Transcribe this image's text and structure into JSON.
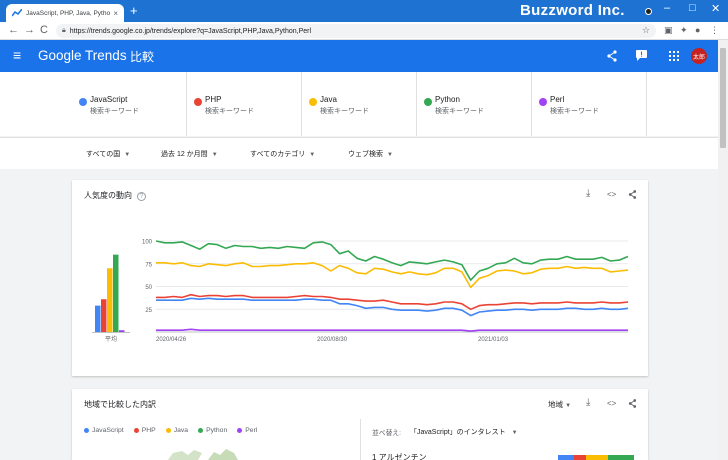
{
  "browser": {
    "tab_title": "JavaScript, PHP, Java, Python, Per",
    "tab_close": "×",
    "new_tab": "+",
    "brand": "Buzzword Inc.",
    "url": "https://trends.google.co.jp/trends/explore?q=JavaScript,PHP,Java,Python,Perl",
    "win_min": "–",
    "win_max": "□",
    "win_close": "✕",
    "back": "←",
    "forward": "→",
    "reload": "C"
  },
  "header": {
    "menu_icon": "≡",
    "logo_google": "Google",
    "logo_trends": " Trends",
    "title": "比較",
    "share_icon": "<",
    "feedback_icon": "!",
    "apps_icon": "⋮⋮⋮",
    "avatar_text": "太郎",
    "avatar_color": "#c5221f"
  },
  "terms": [
    {
      "name": "JavaScript",
      "sub": "検索キーワード",
      "color": "#4285f4"
    },
    {
      "name": "PHP",
      "sub": "検索キーワード",
      "color": "#ea4335"
    },
    {
      "name": "Java",
      "sub": "検索キーワード",
      "color": "#fbbc04"
    },
    {
      "name": "Python",
      "sub": "検索キーワード",
      "color": "#34a853"
    },
    {
      "name": "Perl",
      "sub": "検索キーワード",
      "color": "#a142f4"
    }
  ],
  "filters": [
    {
      "label": "すべての国"
    },
    {
      "label": "過去 12 か月間"
    },
    {
      "label": "すべてのカテゴリ"
    },
    {
      "label": "ウェブ検索"
    }
  ],
  "interest_card": {
    "title": "人気度の動向",
    "help": "?",
    "download_icon": "⤓",
    "embed_icon": "<>",
    "share_icon": "⋖",
    "avg_label": "平均"
  },
  "region_card": {
    "title": "地域で比較した内訳",
    "region_select": "地域",
    "sort_label": "並べ替え:",
    "sort_value": "「JavaScript」のインタレスト",
    "first_row": "1 アルゼンチン",
    "legend": [
      "JavaScript",
      "PHP",
      "Java",
      "Python",
      "Perl"
    ]
  },
  "chart_data": {
    "type": "line",
    "yticks": [
      25,
      50,
      75,
      100
    ],
    "ylim": [
      0,
      100
    ],
    "xtick_labels": [
      "2020/04/26",
      "2020/08/30",
      "2021/01/03"
    ],
    "averages": [
      {
        "name": "JavaScript",
        "value": 29
      },
      {
        "name": "PHP",
        "value": 36
      },
      {
        "name": "Java",
        "value": 70
      },
      {
        "name": "Python",
        "value": 85
      },
      {
        "name": "Perl",
        "value": 2
      }
    ],
    "series": [
      {
        "name": "Python",
        "color": "#34a853",
        "values": [
          100,
          98,
          98,
          99,
          95,
          91,
          97,
          96,
          92,
          95,
          94,
          94,
          92,
          93,
          92,
          94,
          93,
          92,
          98,
          99,
          96,
          86,
          89,
          81,
          78,
          83,
          80,
          76,
          73,
          77,
          76,
          75,
          77,
          79,
          77,
          74,
          57,
          67,
          70,
          75,
          76,
          81,
          76,
          75,
          79,
          80,
          80,
          83,
          80,
          80,
          80,
          82,
          78,
          79,
          83
        ]
      },
      {
        "name": "Java",
        "color": "#fbbc04",
        "values": [
          76,
          76,
          75,
          76,
          73,
          72,
          75,
          74,
          73,
          75,
          76,
          72,
          72,
          73,
          73,
          74,
          75,
          75,
          76,
          73,
          67,
          73,
          70,
          65,
          64,
          70,
          69,
          66,
          64,
          66,
          64,
          63,
          65,
          70,
          70,
          66,
          49,
          59,
          62,
          67,
          68,
          67,
          64,
          65,
          69,
          70,
          70,
          72,
          70,
          71,
          70,
          70,
          66,
          67,
          68
        ]
      },
      {
        "name": "PHP",
        "color": "#ea4335",
        "values": [
          38,
          38,
          39,
          38,
          41,
          39,
          40,
          40,
          39,
          40,
          40,
          38,
          38,
          38,
          38,
          38,
          39,
          40,
          39,
          39,
          38,
          36,
          36,
          35,
          34,
          34,
          35,
          33,
          31,
          31,
          31,
          30,
          31,
          33,
          33,
          31,
          25,
          29,
          30,
          30,
          31,
          32,
          32,
          31,
          32,
          32,
          32,
          33,
          32,
          32,
          32,
          33,
          32,
          32,
          33
        ]
      },
      {
        "name": "JavaScript",
        "color": "#4285f4",
        "values": [
          35,
          35,
          35,
          35,
          37,
          36,
          37,
          36,
          36,
          36,
          36,
          35,
          35,
          35,
          35,
          35,
          35,
          36,
          36,
          35,
          35,
          31,
          31,
          29,
          26,
          27,
          27,
          25,
          24,
          24,
          24,
          23,
          24,
          26,
          26,
          24,
          18,
          22,
          23,
          24,
          24,
          25,
          25,
          24,
          25,
          25,
          25,
          26,
          26,
          25,
          25,
          26,
          25,
          25,
          26
        ]
      },
      {
        "name": "Perl",
        "color": "#a142f4",
        "values": [
          2,
          2,
          2,
          2,
          3,
          2,
          2,
          2,
          2,
          2,
          2,
          2,
          2,
          2,
          2,
          2,
          2,
          2,
          2,
          2,
          2,
          2,
          2,
          2,
          2,
          2,
          2,
          2,
          2,
          2,
          2,
          2,
          2,
          2,
          2,
          2,
          1,
          2,
          2,
          2,
          2,
          2,
          2,
          2,
          2,
          2,
          2,
          2,
          2,
          2,
          2,
          2,
          2,
          2,
          2
        ]
      }
    ]
  }
}
